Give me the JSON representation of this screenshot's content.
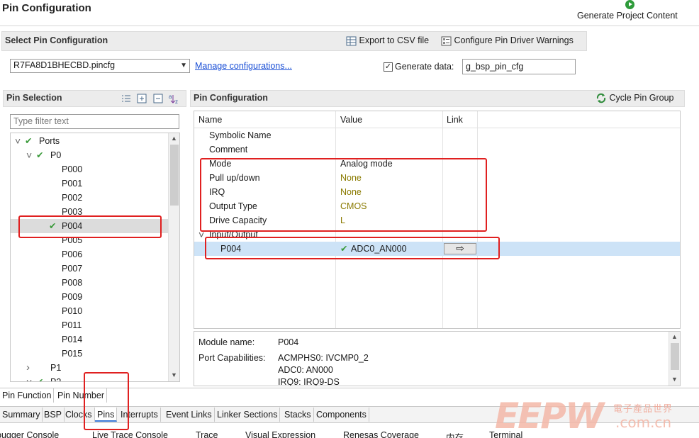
{
  "header": {
    "title": "Pin Configuration",
    "generate_label": "Generate Project Content"
  },
  "select_config": {
    "title": "Select Pin Configuration",
    "export_label": "Export to CSV file",
    "warnings_label": "Configure Pin Driver Warnings",
    "file_value": "R7FA8D1BHECBD.pincfg",
    "manage_link": "Manage configurations...",
    "generate_data_label": "Generate data:",
    "generate_data_checked": true,
    "generate_data_value": "g_bsp_pin_cfg"
  },
  "pin_selection": {
    "title": "Pin Selection",
    "filter_placeholder": "Type filter text",
    "rows": [
      {
        "label": "Ports",
        "level": 0,
        "expanded": true,
        "check": true
      },
      {
        "label": "P0",
        "level": 1,
        "expanded": true,
        "check": true
      },
      {
        "label": "P000",
        "level": 2
      },
      {
        "label": "P001",
        "level": 2
      },
      {
        "label": "P002",
        "level": 2
      },
      {
        "label": "P003",
        "level": 2
      },
      {
        "label": "P004",
        "level": 2,
        "check": true,
        "selected": true
      },
      {
        "label": "P005",
        "level": 2
      },
      {
        "label": "P006",
        "level": 2
      },
      {
        "label": "P007",
        "level": 2
      },
      {
        "label": "P008",
        "level": 2
      },
      {
        "label": "P009",
        "level": 2
      },
      {
        "label": "P010",
        "level": 2
      },
      {
        "label": "P011",
        "level": 2
      },
      {
        "label": "P014",
        "level": 2
      },
      {
        "label": "P015",
        "level": 2
      },
      {
        "label": "P1",
        "level": 1,
        "expanded": false
      },
      {
        "label": "P2",
        "level": 1,
        "expanded": true,
        "check": true
      }
    ]
  },
  "pin_config": {
    "title": "Pin Configuration",
    "cycle_label": "Cycle Pin Group",
    "columns": [
      "Name",
      "Value",
      "Link"
    ],
    "rows": [
      {
        "name": "Symbolic Name",
        "value": ""
      },
      {
        "name": "Comment",
        "value": ""
      },
      {
        "name": "Mode",
        "value": "Analog mode"
      },
      {
        "name": "Pull up/down",
        "value": "None"
      },
      {
        "name": "IRQ",
        "value": "None"
      },
      {
        "name": "Output Type",
        "value": "CMOS"
      },
      {
        "name": "Drive Capacity",
        "value": "L"
      },
      {
        "name": "Input/Output",
        "value": ""
      },
      {
        "name": "P004",
        "value": "ADC0_AN000"
      }
    ]
  },
  "module_info": {
    "module_name_label": "Module name:",
    "module_name_value": "P004",
    "port_caps_label": "Port Capabilities:",
    "caps": [
      "ACMPHS0: IVCMP0_2",
      "ADC0: AN000",
      "IRQ9: IRQ9-DS"
    ]
  },
  "view_tabs": [
    "Pin Function",
    "Pin Number"
  ],
  "bottom_tabs": [
    "Summary",
    "BSP",
    "Clocks",
    "Pins",
    "Interrupts",
    "Event Links",
    "Linker Sections",
    "Stacks",
    "Components"
  ],
  "console_tabs": [
    "bugger Console",
    "Live Trace Console",
    "Trace",
    "Visual Expression",
    "Renesas Coverage",
    "内存",
    "Terminal"
  ],
  "watermark": {
    "brand": "EEPW",
    "cn": "電子產品世界",
    "domain": ".com.cn"
  },
  "colors": {
    "accent": "#3a78d6",
    "highlight": "#cde3f7",
    "annotation": "#e02020",
    "watermark": "#f4b8a8"
  }
}
